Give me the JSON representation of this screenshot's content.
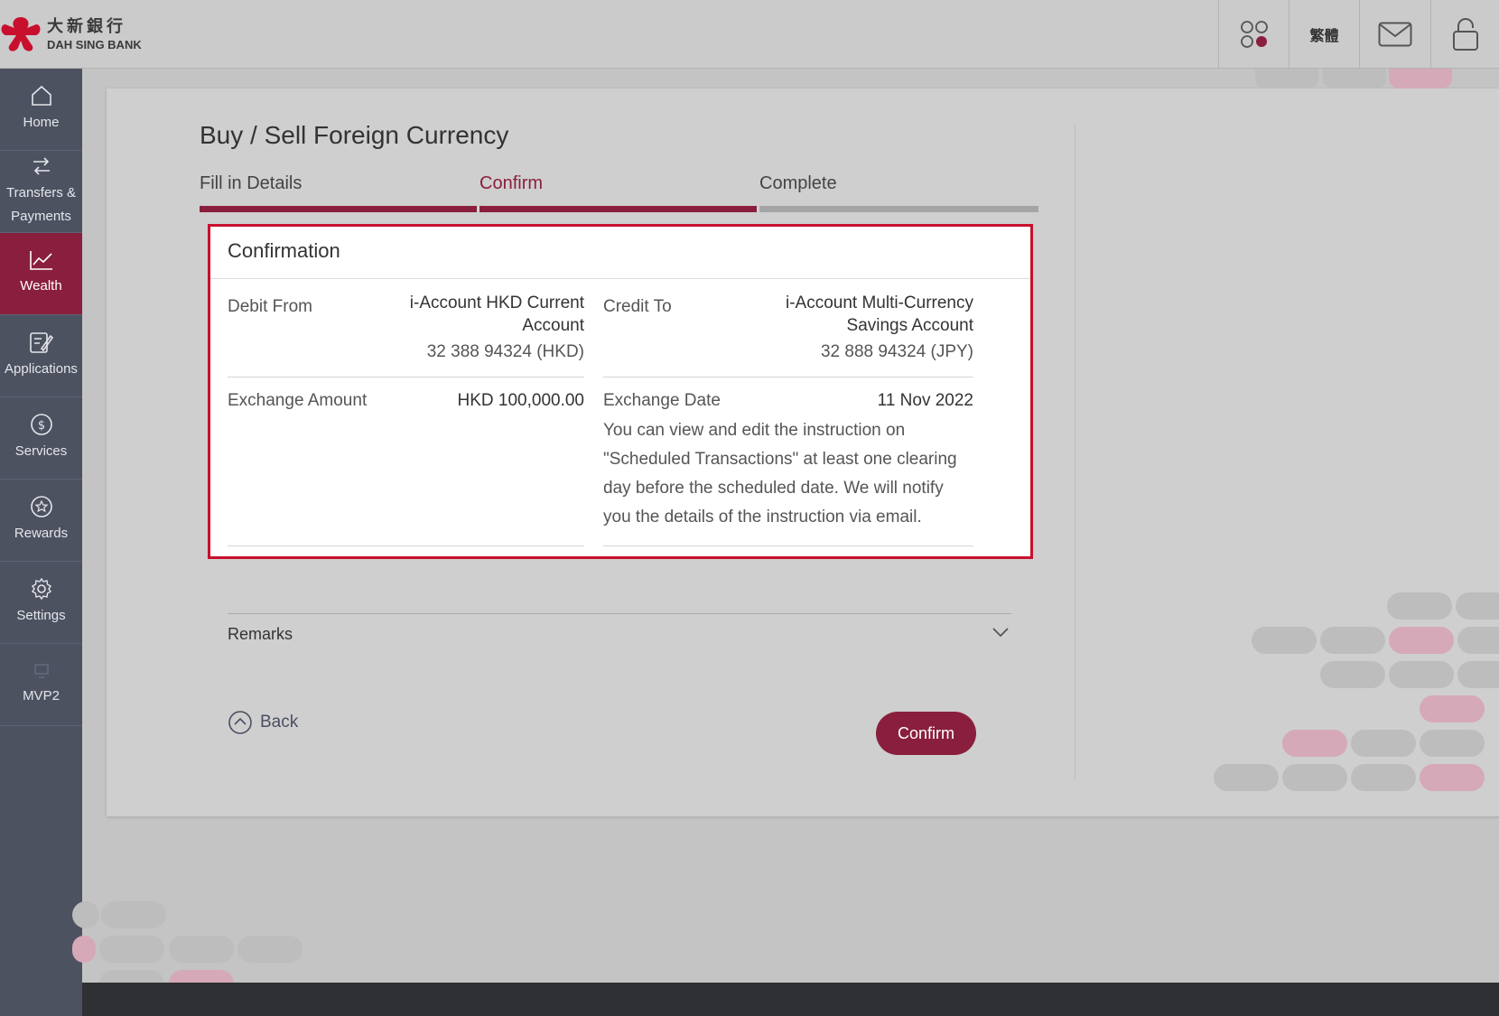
{
  "colors": {
    "brand": "#8a1f3d",
    "highlight_border": "#c8102e",
    "sidebar": "#4d5261",
    "step_inactive": "#a5a5a5"
  },
  "header": {
    "logo_cn": "大新銀行",
    "logo_en": "DAH SING BANK",
    "apps_icon": "apps-grid-icon",
    "language_label": "繁體",
    "mail_icon": "mail-icon",
    "lock_icon": "lock-icon"
  },
  "sidebar": {
    "items": [
      {
        "label": "Home",
        "icon": "home-icon"
      },
      {
        "label": "Transfers & Payments",
        "icon": "transfer-icon"
      },
      {
        "label": "Wealth",
        "icon": "chart-icon",
        "active": true
      },
      {
        "label": "Applications",
        "icon": "edit-document-icon"
      },
      {
        "label": "Services",
        "icon": "dollar-circle-icon"
      },
      {
        "label": "Rewards",
        "icon": "star-circle-icon"
      },
      {
        "label": "Settings",
        "icon": "gear-icon"
      },
      {
        "label": "MVP2",
        "icon": "monitor-icon"
      }
    ]
  },
  "page": {
    "title": "Buy / Sell Foreign Currency",
    "steps": [
      {
        "label": "Fill in Details",
        "state": "done"
      },
      {
        "label": "Confirm",
        "state": "active"
      },
      {
        "label": "Complete",
        "state": "pending"
      }
    ]
  },
  "confirmation": {
    "title": "Confirmation",
    "debit_from": {
      "label": "Debit From",
      "account_line1": "i-Account HKD Current",
      "account_line2": "Account",
      "number": "32 388 94324 (HKD)"
    },
    "credit_to": {
      "label": "Credit To",
      "account_line1": "i-Account Multi-Currency",
      "account_line2": "Savings Account",
      "number": "32 888 94324 (JPY)"
    },
    "exchange_amount": {
      "label": "Exchange Amount",
      "value": "HKD 100,000.00"
    },
    "exchange_date": {
      "label": "Exchange Date",
      "value": "11 Nov 2022",
      "note": "You can view and edit the instruction on \"Scheduled Transactions\" at least one clearing day before the scheduled date. We will notify you the details of the instruction via email."
    }
  },
  "remarks": {
    "label": "Remarks",
    "icon": "chevron-down-icon"
  },
  "actions": {
    "back_label": "Back",
    "back_icon": "chevron-up-circle-icon",
    "confirm_label": "Confirm"
  }
}
